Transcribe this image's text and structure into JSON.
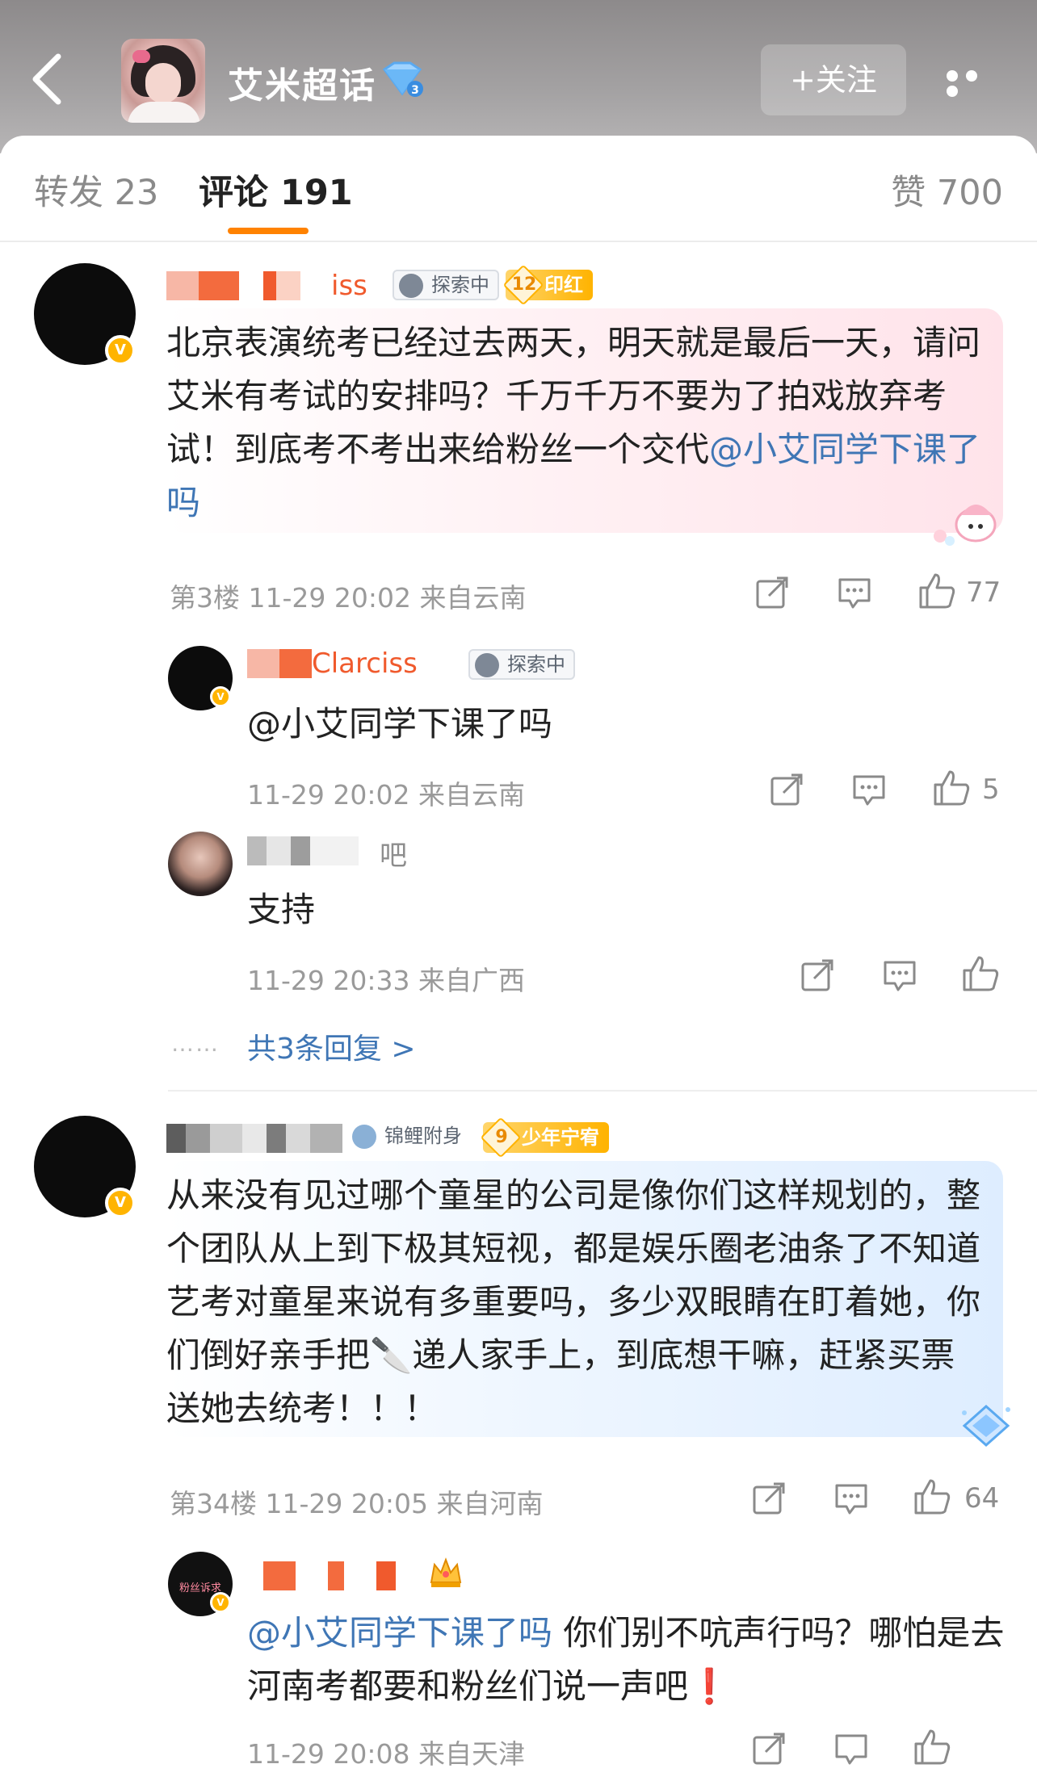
{
  "header": {
    "title": "艾米超话",
    "follow_label": "+关注"
  },
  "tabs": [
    {
      "label": "转发 23"
    },
    {
      "label": "评论 191"
    },
    {
      "label": "赞 700"
    }
  ],
  "comments": [
    {
      "username_visible": "iss",
      "badges": [
        "探索中",
        "印红"
      ],
      "badge_level": "12",
      "text": "北京表演统考已经过去两天，明天就是最后一天，请问艾米有考试的安排吗？千万千万不要为了拍戏放弃考试！到底考不考出来给粉丝一个交代",
      "mention": "@小艾同学下课了吗",
      "meta": "第3楼 11-29 20:02 来自云南",
      "likes": "77",
      "replies": [
        {
          "username_visible": "Clarciss",
          "badge": "探索中",
          "text": "",
          "mention": "@小艾同学下课了吗",
          "meta": "11-29 20:02 来自云南",
          "likes": "5"
        },
        {
          "username_visible": "吧",
          "text": "支持",
          "meta": "11-29 20:33 来自广西",
          "likes": ""
        }
      ],
      "more_replies": "共3条回复 >",
      "dots": "……"
    },
    {
      "badges": [
        "锦鲤附身",
        "少年宁宥"
      ],
      "badge_level": "9",
      "text": "从来没有见过哪个童星的公司是像你们这样规划的，整个团队从上到下极其短视，都是娱乐圈老油条了不知道艺考对童星来说有多重要吗，多少双眼睛在盯着她，你们倒好亲手把🔪递人家手上，到底想干嘛，赶紧买票送她去统考！！！",
      "meta": "第34楼 11-29 20:05 来自河南",
      "likes": "64",
      "replies": [
        {
          "avatar_label": "粉丝诉求",
          "mention": "@小艾同学下课了吗",
          "text": " 你们别不吭声行吗？哪怕是去河南考都要和粉丝们说一声吧❗",
          "meta": "11-29 20:08 来自天津"
        }
      ]
    }
  ],
  "colors": {
    "accent": "#ff8200",
    "mention": "#3f76b5",
    "gold_badge": "#ffb300",
    "verified": "#ffb400"
  },
  "icons": [
    "back-arrow-icon",
    "diamond-level-icon",
    "more-dots-icon",
    "share-icon",
    "comment-icon",
    "like-icon",
    "verified-badge-icon",
    "crown-icon"
  ]
}
